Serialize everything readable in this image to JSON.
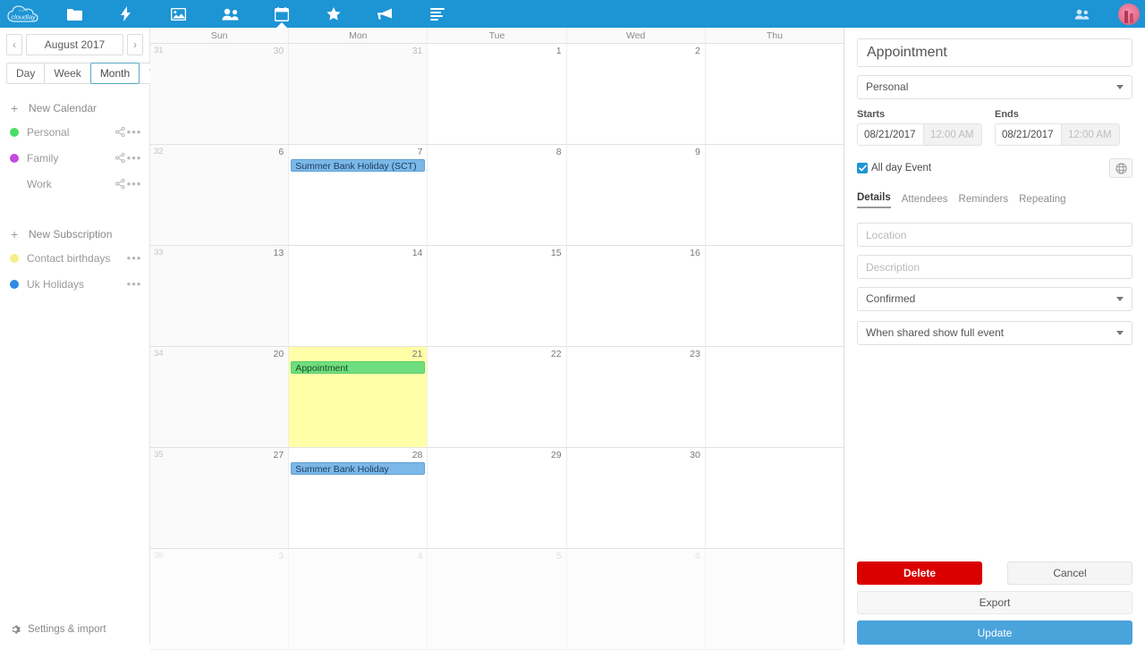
{
  "topbar": {
    "logo_text": "cloudlay",
    "icons": [
      {
        "name": "files-icon",
        "label": "Files"
      },
      {
        "name": "activity-icon",
        "label": "Activity"
      },
      {
        "name": "photos-icon",
        "label": "Photos"
      },
      {
        "name": "contacts-icon",
        "label": "Contacts"
      },
      {
        "name": "calendar-icon",
        "label": "Calendar",
        "active": true
      },
      {
        "name": "favorites-icon",
        "label": "Favorites"
      },
      {
        "name": "announcements-icon",
        "label": "Announcements"
      },
      {
        "name": "tasks-icon",
        "label": "Tasks"
      }
    ],
    "right_icons": [
      {
        "name": "contacts-menu-icon",
        "label": "Contacts"
      }
    ],
    "avatar_label": "User avatar"
  },
  "sidebar": {
    "prev_label": "‹",
    "next_label": "›",
    "month_label": "August 2017",
    "views": [
      {
        "label": "Day",
        "selected": false
      },
      {
        "label": "Week",
        "selected": false
      },
      {
        "label": "Month",
        "selected": true
      }
    ],
    "today_label": "Today",
    "new_calendar_label": "New Calendar",
    "calendars": [
      {
        "name": "Personal",
        "color": "#4ddd6a",
        "share": true
      },
      {
        "name": "Family",
        "color": "#c44ae0",
        "share": true
      },
      {
        "name": "Work",
        "color": "",
        "share": true
      }
    ],
    "new_subscription_label": "New Subscription",
    "subscriptions": [
      {
        "name": "Contact birthdays",
        "color": "#f5ef8a",
        "share": false
      },
      {
        "name": "Uk Holidays",
        "color": "#2e8ae0",
        "share": false
      }
    ],
    "settings_label": "Settings & import"
  },
  "calendar": {
    "day_headers": [
      "Sun",
      "Mon",
      "Tue",
      "Wed",
      "Thu"
    ],
    "weeks": [
      {
        "week_number": "31",
        "faded": false,
        "days": [
          {
            "num": "30",
            "other_month": true,
            "selected": false,
            "events": []
          },
          {
            "num": "31",
            "other_month": true,
            "selected": false,
            "events": []
          },
          {
            "num": "1",
            "other_month": false,
            "selected": false,
            "events": []
          },
          {
            "num": "2",
            "other_month": false,
            "selected": false,
            "events": []
          },
          {
            "num": "",
            "other_month": false,
            "selected": false,
            "events": []
          }
        ]
      },
      {
        "week_number": "32",
        "faded": false,
        "days": [
          {
            "num": "6",
            "other_month": false,
            "selected": false,
            "events": []
          },
          {
            "num": "7",
            "other_month": false,
            "selected": false,
            "events": [
              {
                "title": "Summer Bank Holiday (SCT)",
                "color": "blue"
              }
            ]
          },
          {
            "num": "8",
            "other_month": false,
            "selected": false,
            "events": []
          },
          {
            "num": "9",
            "other_month": false,
            "selected": false,
            "events": []
          },
          {
            "num": "",
            "other_month": false,
            "selected": false,
            "events": []
          }
        ]
      },
      {
        "week_number": "33",
        "faded": false,
        "days": [
          {
            "num": "13",
            "other_month": false,
            "selected": false,
            "events": []
          },
          {
            "num": "14",
            "other_month": false,
            "selected": false,
            "events": []
          },
          {
            "num": "15",
            "other_month": false,
            "selected": false,
            "events": []
          },
          {
            "num": "16",
            "other_month": false,
            "selected": false,
            "events": []
          },
          {
            "num": "",
            "other_month": false,
            "selected": false,
            "events": []
          }
        ]
      },
      {
        "week_number": "34",
        "faded": false,
        "days": [
          {
            "num": "20",
            "other_month": false,
            "selected": false,
            "events": []
          },
          {
            "num": "21",
            "other_month": false,
            "selected": true,
            "events": [
              {
                "title": "Appointment",
                "color": "green"
              }
            ]
          },
          {
            "num": "22",
            "other_month": false,
            "selected": false,
            "events": []
          },
          {
            "num": "23",
            "other_month": false,
            "selected": false,
            "events": []
          },
          {
            "num": "",
            "other_month": false,
            "selected": false,
            "events": []
          }
        ]
      },
      {
        "week_number": "35",
        "faded": false,
        "days": [
          {
            "num": "27",
            "other_month": false,
            "selected": false,
            "events": []
          },
          {
            "num": "28",
            "other_month": false,
            "selected": false,
            "events": [
              {
                "title": "Summer Bank Holiday",
                "color": "blue"
              }
            ]
          },
          {
            "num": "29",
            "other_month": false,
            "selected": false,
            "events": []
          },
          {
            "num": "30",
            "other_month": false,
            "selected": false,
            "events": []
          },
          {
            "num": "",
            "other_month": false,
            "selected": false,
            "events": []
          }
        ]
      },
      {
        "week_number": "36",
        "faded": true,
        "days": [
          {
            "num": "3",
            "other_month": true,
            "selected": false,
            "events": []
          },
          {
            "num": "4",
            "other_month": true,
            "selected": false,
            "events": []
          },
          {
            "num": "5",
            "other_month": true,
            "selected": false,
            "events": []
          },
          {
            "num": "6",
            "other_month": true,
            "selected": false,
            "events": []
          },
          {
            "num": "",
            "other_month": true,
            "selected": false,
            "events": []
          }
        ]
      }
    ]
  },
  "panel": {
    "title_value": "Appointment",
    "calendar_value": "Personal",
    "starts_label": "Starts",
    "ends_label": "Ends",
    "starts_date": "08/21/2017",
    "starts_time": "12:00 AM",
    "ends_date": "08/21/2017",
    "ends_time": "12:00 AM",
    "allday_label": "All day Event",
    "allday_checked": true,
    "globe_icon": "globe-icon",
    "tabs": [
      {
        "label": "Details",
        "active": true
      },
      {
        "label": "Attendees",
        "active": false
      },
      {
        "label": "Reminders",
        "active": false
      },
      {
        "label": "Repeating",
        "active": false
      }
    ],
    "location_placeholder": "Location",
    "location_value": "",
    "description_placeholder": "Description",
    "description_value": "",
    "status_value": "Confirmed",
    "sharing_value": "When shared show full event",
    "delete_label": "Delete",
    "cancel_label": "Cancel",
    "export_label": "Export",
    "update_label": "Update"
  },
  "colors": {
    "brand_blue": "#1d94d4",
    "danger_red": "#db0000",
    "primary_blue": "#4ba3dc",
    "selected_day": "#ffffa8",
    "event_blue": "#7bb8e8",
    "event_green": "#6ede7e"
  }
}
